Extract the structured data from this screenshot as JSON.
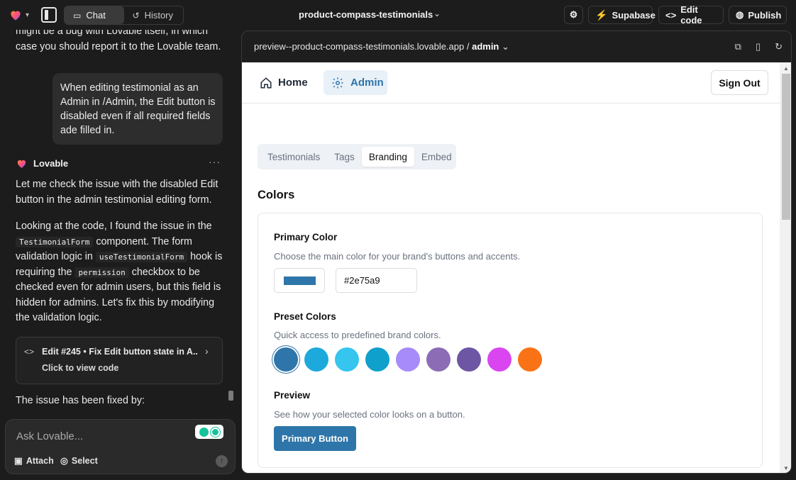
{
  "topbar": {
    "chat_label": "Chat",
    "history_label": "History",
    "project_name": "product-compass-testimonials",
    "supabase_label": "Supabase",
    "edit_code_label": "Edit code",
    "publish_label": "Publish"
  },
  "chat": {
    "prev_text": "might be a bug with Lovable itself, in which case you should report it to the Lovable team.",
    "user_message": "When editing testimonial as an Admin in /Admin, the Edit button is disabled even if all required fields ade filled in.",
    "assistant_name": "Lovable",
    "p1": "Let me check the issue with the disabled Edit button in the admin testimonial editing form.",
    "p2_a": "Looking at the code, I found the issue in the",
    "p2_code1": "TestimonialForm",
    "p2_b": "component. The form validation logic in",
    "p2_code2": "useTestimonialForm",
    "p2_c": "hook is requiring the",
    "p2_code3": "permission",
    "p2_d": "checkbox to be checked even for admin users, but this field is hidden for admins. Let's fix this by modifying the validation logic.",
    "edit_card_title": "Edit #245 • Fix Edit button state in A...",
    "edit_card_sub": "Click to view code",
    "p3": "The issue has been fixed by:",
    "composer_placeholder": "Ask Lovable...",
    "attach_label": "Attach",
    "select_label": "Select"
  },
  "preview": {
    "url_prefix": "preview--product-compass-testimonials.lovable.app /",
    "url_path": "admin"
  },
  "site": {
    "nav_home": "Home",
    "nav_admin": "Admin",
    "sign_out": "Sign Out",
    "tabs": [
      "Testimonials",
      "Tags",
      "Branding",
      "Embed"
    ],
    "active_tab": "Branding",
    "colors_heading": "Colors",
    "primary_color_label": "Primary Color",
    "primary_color_desc": "Choose the main color for your brand's buttons and accents.",
    "primary_color_value": "#2e75a9",
    "preset_label": "Preset Colors",
    "preset_desc": "Quick access to predefined brand colors.",
    "preset_colors": [
      "#2e75a9",
      "#1ea9dc",
      "#35c5ef",
      "#0fa0cc",
      "#a78bfa",
      "#8b6cb5",
      "#6d56a4",
      "#d946ef",
      "#f97316"
    ],
    "preview_label": "Preview",
    "preview_desc": "See how your selected color looks on a button.",
    "preview_button": "Primary Button"
  },
  "colors": {
    "accent": "#2e75a9",
    "supabase_green": "#3ecf8e",
    "dark_bg": "#1c1c1c"
  }
}
